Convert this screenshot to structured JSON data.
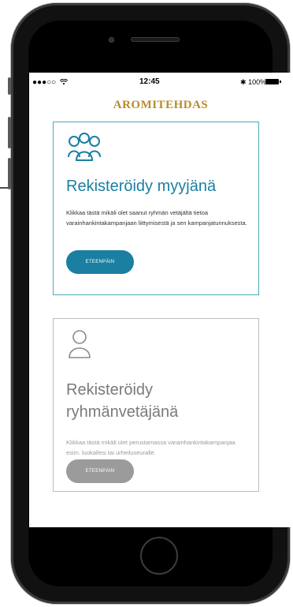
{
  "status_bar": {
    "signal": "●●●○○",
    "time": "12:45",
    "battery_pct": "100%"
  },
  "brand": "AROMITEHDAS",
  "cards": [
    {
      "title": "Rekisteröidy myyjänä",
      "description": "Klikkaa tästä mikäli olet saanut ryhmän vetäjältä tietoa varainhankintakampanjaan liittymisestä ja sen kampanjatunnuksesta.",
      "button_label": "ETEENPÄIN",
      "icon": "group-icon",
      "accent": "#1a7fa1"
    },
    {
      "title": "Rekisteröidy ryhmänvetäjänä",
      "description": "Klikkaa tästä mikäli olet perustamassa varainhankintakampanjaa esim. luokallesi tai urheiluseuralle.",
      "button_label": "ETEENPÄIN",
      "icon": "person-icon",
      "accent": "#9b9b9b"
    }
  ]
}
